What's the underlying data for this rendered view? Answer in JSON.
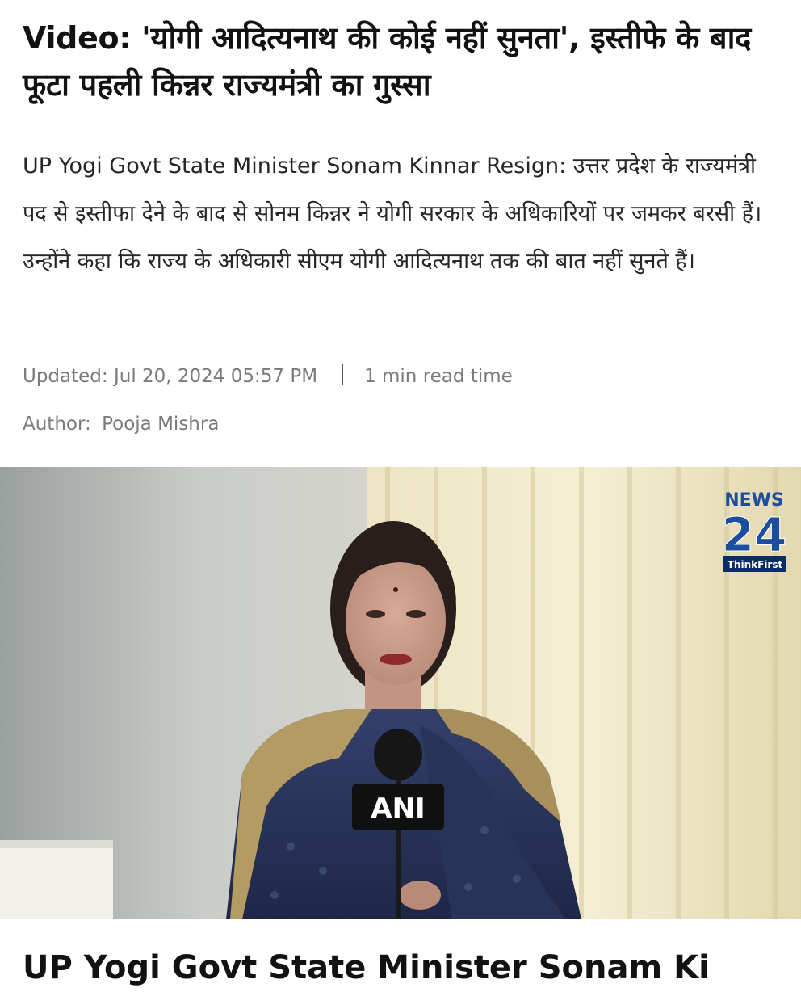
{
  "article": {
    "headline": "Video: 'योगी आदित्यनाथ की कोई नहीं सुनता', इस्तीफे के बाद फूटा पहली किन्नर राज्यमंत्री का गुस्सा",
    "summary": "UP Yogi Govt State Minister Sonam Kinnar Resign: उत्तर प्रदेश के राज्यमंत्री पद से इस्तीफा देने के बाद से सोनम किन्नर ने योगी सरकार के अधिकारियों पर जमकर बरसी हैं। उन्होंने कहा कि राज्य के अधिकारी सीएम योगी आदित्यनाथ तक की बात नहीं सुनते हैं।",
    "updated": "Updated: Jul 20, 2024 05:57 PM",
    "read_time": "1 min read time",
    "author_label": "Author:",
    "author_name": "Pooja Mishra"
  },
  "hero_image": {
    "channel_logo": {
      "line1": "NEWS",
      "line2": "24",
      "tagline": "ThinkFirst"
    },
    "mic_label": "ANI"
  },
  "next_article": {
    "headline_partial": "UP Yogi Govt State Minister Sonam Ki"
  },
  "colors": {
    "text": "#121212",
    "meta": "#7a7a7a",
    "logo_blue": "#1d4e9e",
    "logo_navy": "#0c2c66"
  }
}
